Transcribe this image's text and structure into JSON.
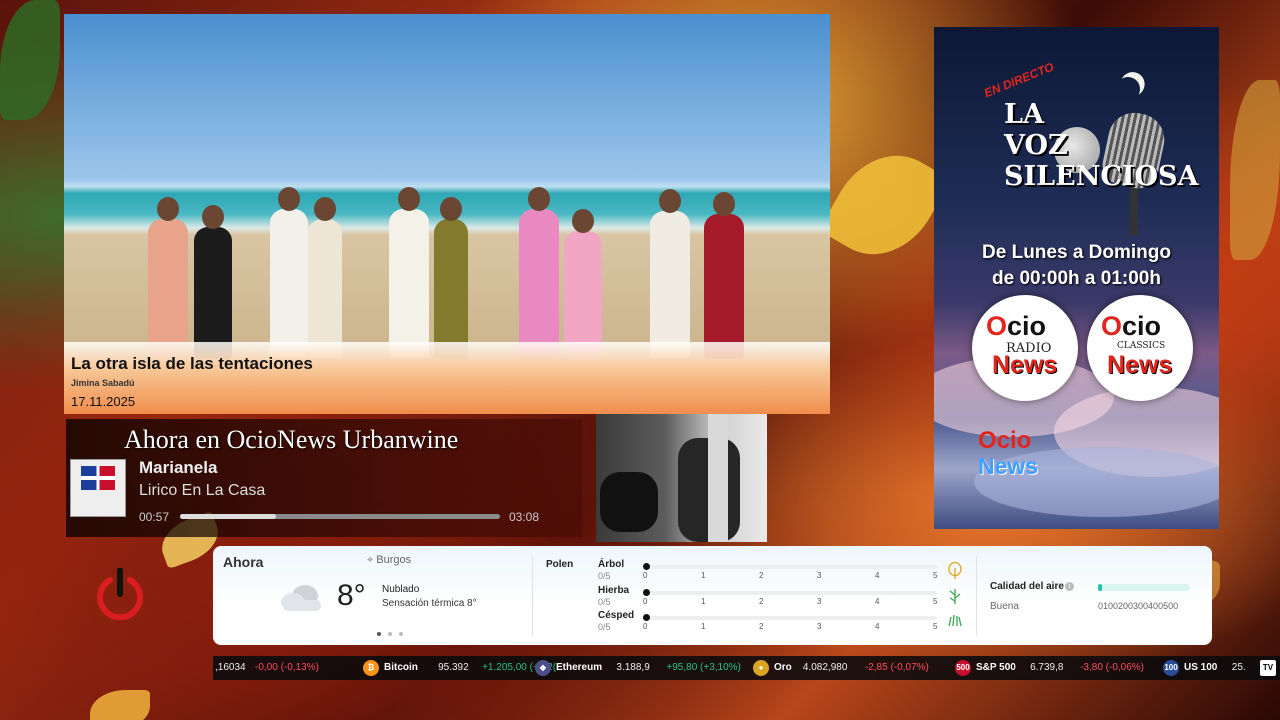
{
  "news": {
    "title": "La otra isla de las tentaciones",
    "author": "Jimina Sabadú",
    "date": "17.11.2025"
  },
  "promo": {
    "live_tag": "EN DIRECTO",
    "title_line1": "LA",
    "title_line2": "VOZ",
    "title_line3": "SILENCIOSA",
    "schedule_days": "De Lunes a Domingo",
    "schedule_hours": "de 00:00h a 01:00h",
    "logo_radio": {
      "ocio": "Ocio",
      "sub": "RADIO",
      "news": "News"
    },
    "logo_classics": {
      "ocio": "Ocio",
      "sub": "CLASSICS",
      "news": "News"
    },
    "brand_ocio": "Ocio",
    "brand_news": "News"
  },
  "now_playing": {
    "heading": "Ahora en OcioNews Urbanwine",
    "artist": "Marianela",
    "album": "Lirico En La Casa",
    "elapsed": "00:57",
    "total": "03:08",
    "progress": 0.3
  },
  "weather": {
    "now_label": "Ahora",
    "location": "Burgos",
    "temperature": "8°",
    "condition": "Nublado",
    "feels_like": "Sensación térmica 8°",
    "pollen_label": "Polen",
    "pollen": [
      {
        "name": "Árbol",
        "score": "0/5",
        "value": 0
      },
      {
        "name": "Hierba",
        "score": "0/5",
        "value": 0
      },
      {
        "name": "Césped",
        "score": "0/5",
        "value": 0
      }
    ],
    "pollen_ticks": [
      "0",
      "1",
      "2",
      "3",
      "4",
      "5"
    ],
    "air_quality_label": "Calidad del aire",
    "air_quality_value": "Buena",
    "air_quality_ticks": "0100200300400500",
    "air_quality_level": 0.04,
    "page_dots": 3,
    "active_dot": 0
  },
  "ticker": {
    "lead": {
      "price": ",16034",
      "change": "-0,00 (-0,13%)"
    },
    "items": [
      {
        "name": "Bitcoin",
        "price": "95.392",
        "change": "+1.205,00 (+1,2(",
        "dir": "pos",
        "icon": "bitcoin-icon",
        "glyph": "₿",
        "color": "#f7931a"
      },
      {
        "name": "Ethereum",
        "price": "3.188,9",
        "change": "+95,80 (+3,10%)",
        "dir": "pos",
        "icon": "ethereum-icon",
        "glyph": "◆",
        "color": "#4b4e8a"
      },
      {
        "name": "Oro",
        "price": "4.082,980",
        "change": "-2,85 (-0,07%)",
        "dir": "neg",
        "icon": "gold-icon",
        "glyph": "●",
        "color": "#d9a520"
      },
      {
        "name": "S&P 500",
        "price": "6.739,8",
        "change": "-3,80 (-0,06%)",
        "dir": "neg",
        "icon": "sp500-icon",
        "glyph": "500",
        "color": "#c8102e"
      },
      {
        "name": "US 100",
        "price": "25.",
        "change": "",
        "dir": "neg",
        "icon": "us100-icon",
        "glyph": "100",
        "color": "#2a4d9b"
      }
    ],
    "logo": "TV"
  }
}
